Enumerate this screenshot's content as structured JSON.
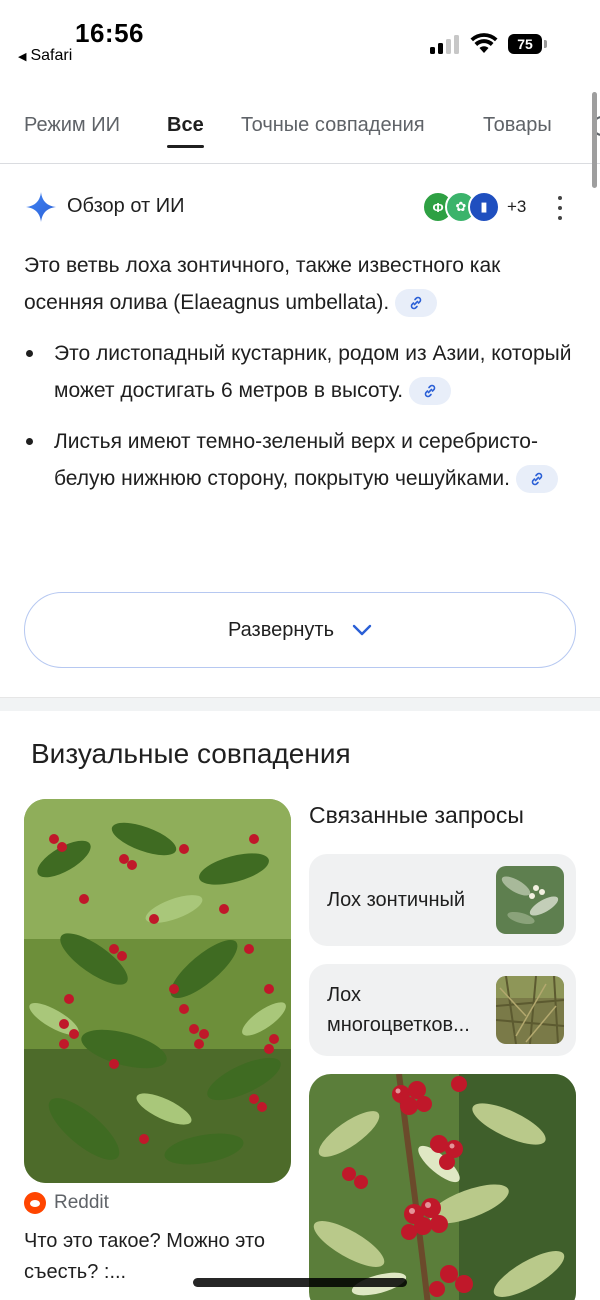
{
  "status_bar": {
    "time": "16:56",
    "back_app": "Safari",
    "battery": "75"
  },
  "tabs": [
    {
      "label": "Режим ИИ",
      "active": false
    },
    {
      "label": "Все",
      "active": true
    },
    {
      "label": "Точные совпадения",
      "active": false
    },
    {
      "label": "Товары",
      "active": false
    }
  ],
  "ai_overview": {
    "title": "Обзор от ИИ",
    "sources_more": "+3",
    "intro": "Это ветвь лоха зонтичного, также известного как осенняя олива (Elaeagnus umbellata).",
    "bullets": [
      "Это листопадный кустарник, родом из Азии, который может достигать 6 метров в высоту.",
      "Листья имеют темно-зеленый верх и серебристо-белую нижнюю сторону, покрытую чешуйками."
    ],
    "expand_label": "Развернуть"
  },
  "visual_matches": {
    "title": "Визуальные совпадения",
    "main_result": {
      "source": "Reddit",
      "title": "Что это такое? Можно это съесть? :..."
    },
    "related": {
      "title": "Связанные запросы",
      "items": [
        {
          "label": "Лох зонтичный"
        },
        {
          "label": "Лох многоцветков..."
        }
      ]
    }
  },
  "colors": {
    "accent": "#4285f4",
    "berry_red": "#c0182a",
    "leaf_green": "#4e7a2c"
  }
}
